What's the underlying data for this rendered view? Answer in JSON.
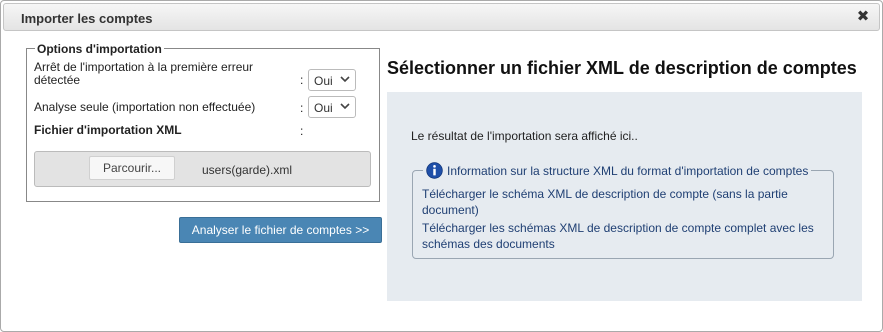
{
  "dialog": {
    "title": "Importer les comptes",
    "close_glyph": "✖"
  },
  "options": {
    "legend": "Options d'importation",
    "stop_on_error": {
      "label": "Arrêt de l'importation à la première erreur détectée",
      "colon": ":",
      "value": "Oui"
    },
    "analysis_only": {
      "label": "Analyse seule (importation non effectuée)",
      "colon": ":",
      "value": "Oui"
    },
    "import_file": {
      "label": "Fichier d'importation XML",
      "colon": ":"
    },
    "browse_label": "Parcourir...",
    "filename": "users(garde).xml"
  },
  "analyse_button": "Analyser le fichier de comptes >>",
  "right": {
    "title": "Sélectionner un fichier XML de description de comptes",
    "result_text": "Le résultat de l'importation sera affiché ici..",
    "info_title": "Information sur la structure XML du format d'importation de comptes",
    "link_schema_partial": "Télécharger le schéma XML de description de compte (sans la partie document)",
    "link_schema_full": "Télécharger les schémas XML de description de compte complet avec les schémas des documents"
  },
  "colors": {
    "accent_button": "#4a86b4",
    "link": "#1f3f73",
    "panel": "#e6ebf0"
  },
  "icons": [
    "close-icon",
    "chevron-down-icon",
    "info-icon"
  ]
}
